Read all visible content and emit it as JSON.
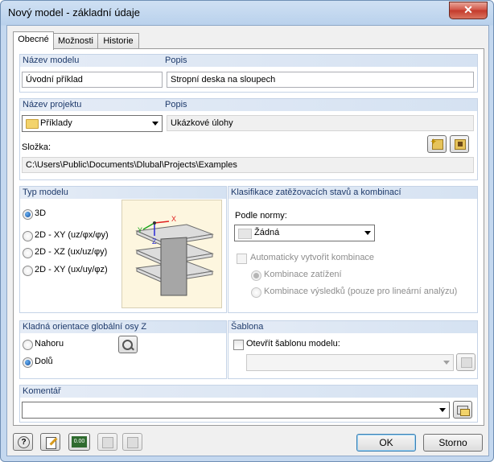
{
  "window": {
    "title": "Nový model - základní údaje",
    "close_label": "✕"
  },
  "tabs": [
    {
      "label": "Obecné"
    },
    {
      "label": "Možnosti"
    },
    {
      "label": "Historie"
    }
  ],
  "model": {
    "name_header": "Název modelu",
    "name_value": "Úvodní příklad",
    "desc_header": "Popis",
    "desc_value": "Stropní deska na sloupech"
  },
  "project": {
    "name_header": "Název projektu",
    "name_value": "Příklady",
    "desc_header": "Popis",
    "desc_value": "Ukázkové úlohy",
    "folder_label": "Složka:",
    "folder_value": "C:\\Users\\Public\\Documents\\Dlubal\\Projects\\Examples"
  },
  "model_type": {
    "header": "Typ modelu",
    "options": [
      {
        "label": "3D",
        "selected": true
      },
      {
        "label": "2D - XY (uz/φx/φy)",
        "selected": false
      },
      {
        "label": "2D - XZ (ux/uz/φy)",
        "selected": false
      },
      {
        "label": "2D - XY (ux/uy/φz)",
        "selected": false
      }
    ]
  },
  "classification": {
    "header": "Klasifikace zatěžovacích stavů a kombinací",
    "norm_label": "Podle normy:",
    "norm_value": "Žádná",
    "auto_label": "Automaticky vytvořit kombinace",
    "combo_load_label": "Kombinace zatížení",
    "combo_result_label": "Kombinace výsledků (pouze pro lineární analýzu)"
  },
  "orientation": {
    "header": "Kladná orientace globální osy Z",
    "up_label": "Nahoru",
    "down_label": "Dolů"
  },
  "template": {
    "header": "Šablona",
    "open_label": "Otevřít šablonu modelu:",
    "value": ""
  },
  "comment": {
    "header": "Komentář",
    "value": ""
  },
  "footer": {
    "ok_label": "OK",
    "cancel_label": "Storno",
    "num_icon_text": "0.00"
  },
  "axis_labels": {
    "x": "X",
    "y": "Y",
    "z": "Z"
  }
}
